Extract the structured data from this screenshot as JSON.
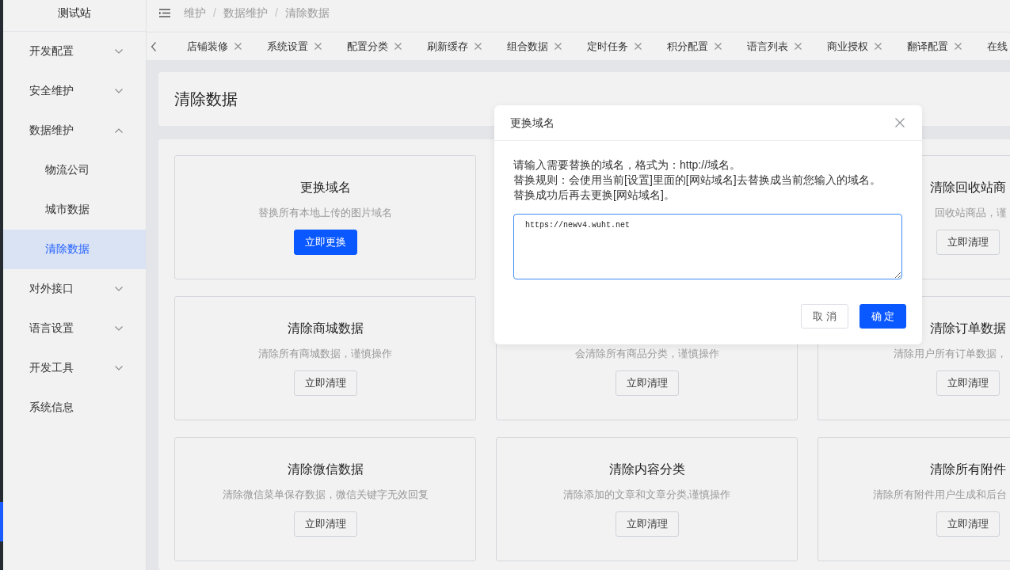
{
  "sidebar": {
    "title": "测试站",
    "items": [
      {
        "label": "开发配置",
        "expanded": false,
        "selected": false
      },
      {
        "label": "安全维护",
        "expanded": false,
        "selected": false
      },
      {
        "label": "数据维护",
        "expanded": true,
        "selected": false,
        "children": [
          {
            "label": "物流公司",
            "selected": false
          },
          {
            "label": "城市数据",
            "selected": false
          },
          {
            "label": "清除数据",
            "selected": true
          }
        ]
      },
      {
        "label": "对外接口",
        "expanded": false,
        "selected": false
      },
      {
        "label": "语言设置",
        "expanded": false,
        "selected": false
      },
      {
        "label": "开发工具",
        "expanded": false,
        "selected": false
      },
      {
        "label": "系统信息",
        "selected": false
      }
    ]
  },
  "breadcrumb": [
    {
      "label": "维护"
    },
    {
      "separator": "/",
      "label": "数据维护"
    },
    {
      "separator": "/",
      "label": "清除数据"
    }
  ],
  "tabs": [
    {
      "label": "店铺装修",
      "selected": false,
      "closable": true
    },
    {
      "label": "系统设置",
      "selected": false,
      "closable": true
    },
    {
      "label": "配置分类",
      "selected": false,
      "closable": true
    },
    {
      "label": "刷新缓存",
      "selected": false,
      "closable": true
    },
    {
      "label": "组合数据",
      "selected": false,
      "closable": true
    },
    {
      "label": "定时任务",
      "selected": false,
      "closable": true
    },
    {
      "label": "积分配置",
      "selected": false,
      "closable": true
    },
    {
      "label": "语言列表",
      "selected": false,
      "closable": true
    },
    {
      "label": "商业授权",
      "selected": false,
      "closable": true
    },
    {
      "label": "翻译配置",
      "selected": false,
      "closable": true
    },
    {
      "label": "在线",
      "selected": false,
      "closable": false
    }
  ],
  "page": {
    "title": "清除数据"
  },
  "card_rows": [
    [
      {
        "title": "更换域名",
        "description": "替换所有本地上传的图片域名",
        "button": {
          "label": "立即更换",
          "kind": "primary"
        }
      },
      {
        "title": "清除回收站商",
        "description": "回收站商品，谨",
        "button": {
          "label": "立即清理",
          "kind": "default"
        }
      }
    ],
    [
      {
        "title": "清除商城数据",
        "description": "清除所有商城数据，谨慎操作",
        "button": {
          "label": "立即清理",
          "kind": "default"
        }
      },
      {
        "description": "会清除所有商品分类，谨慎操作",
        "button": {
          "label": "立即清理",
          "kind": "default"
        }
      },
      {
        "title": "清除订单数据",
        "description": "清除用户所有订单数据，",
        "button": {
          "label": "立即清理",
          "kind": "default"
        }
      }
    ],
    [
      {
        "title": "清除微信数据",
        "description": "清除微信菜单保存数据，微信关键字无效回复",
        "button": {
          "label": "立即清理",
          "kind": "default"
        }
      },
      {
        "title": "清除内容分类",
        "description": "清除添加的文章和文章分类,谨慎操作",
        "button": {
          "label": "立即清理",
          "kind": "default"
        }
      },
      {
        "title": "清除所有附件",
        "description": "清除所有附件用户生成和后台",
        "button": {
          "label": "立即清理",
          "kind": "default"
        }
      }
    ]
  ],
  "dialog": {
    "title": "更换域名",
    "lines": [
      "请输入需要替换的域名，格式为：http://域名。",
      "替换规则：会使用当前[设置]里面的[网站域名]去替换成当前您输入的域名。",
      "替换成功后再去更换[网站域名]。"
    ],
    "input": {
      "value": "https://newv4.wuht.net",
      "focused": true
    },
    "buttons": [
      {
        "label": "取 消",
        "kind": "default"
      },
      {
        "label": "确 定",
        "kind": "primary"
      }
    ]
  }
}
